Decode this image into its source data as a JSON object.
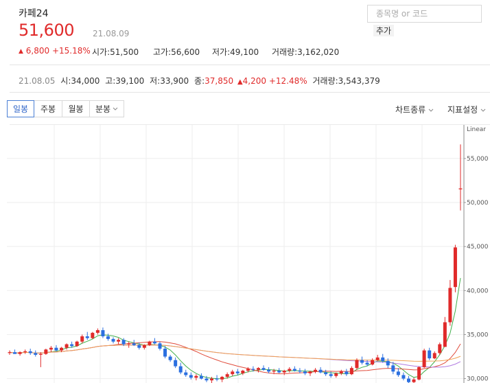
{
  "stock": {
    "name": "카페24",
    "price": "51,600",
    "date": "21.08.09",
    "change_arrow": "▲",
    "change": "6,800",
    "change_pct": "+15.18%",
    "open_label": "시가",
    "open": "51,500",
    "high_label": "고가",
    "high": "56,600",
    "low_label": "저가",
    "low": "49,100",
    "volume_label": "거래량",
    "volume": "3,162,020"
  },
  "search": {
    "placeholder": "종목명 or 코드",
    "add_label": "추가"
  },
  "prev_day": {
    "date": "21.08.05",
    "open_label": "시",
    "open": "34,000",
    "high_label": "고",
    "high": "39,100",
    "low_label": "저",
    "low": "33,900",
    "close_label": "종",
    "close": "37,850",
    "change_arrow": "▲",
    "change": "4,200",
    "change_pct": "+12.48%",
    "volume_label": "거래량",
    "volume": "3,543,379"
  },
  "toolbar": {
    "tabs": [
      "일봉",
      "주봉",
      "월봉",
      "분봉"
    ],
    "active_tab": "일봉",
    "chart_type_label": "차트종류",
    "indicator_label": "지표설정"
  },
  "colors": {
    "up": "#e02a2a",
    "down": "#2b6fe0",
    "ma5": "#3fae49",
    "ma20": "#e04a3a",
    "ma60": "#b07ae0",
    "ma120": "#f0a050",
    "active_tab": "#4a7fd4"
  },
  "chart_data": {
    "type": "candlestick",
    "y_scale_label": "Linear",
    "ylim": [
      29500,
      58500
    ],
    "yticks": [
      "30,000",
      "35,000",
      "40,000",
      "45,000",
      "50,000",
      "55,000"
    ],
    "ytick_values": [
      30000,
      35000,
      40000,
      45000,
      50000,
      55000
    ],
    "last_candle": {
      "open": 51500,
      "high": 56600,
      "low": 49100,
      "close": 51600
    },
    "candles": [
      [
        32900,
        33200,
        32700,
        33000
      ],
      [
        33000,
        33300,
        32800,
        32800
      ],
      [
        32800,
        33100,
        32600,
        33000
      ],
      [
        33000,
        33300,
        32800,
        33100
      ],
      [
        33100,
        33400,
        32700,
        32900
      ],
      [
        32900,
        33200,
        32500,
        32700
      ],
      [
        32700,
        33000,
        31300,
        32800
      ],
      [
        32800,
        33400,
        32700,
        33300
      ],
      [
        33300,
        33700,
        33000,
        33500
      ],
      [
        33500,
        33800,
        33100,
        33200
      ],
      [
        33200,
        33600,
        33000,
        33500
      ],
      [
        33500,
        34000,
        33300,
        33900
      ],
      [
        33900,
        34200,
        33500,
        33700
      ],
      [
        33700,
        34300,
        33600,
        34200
      ],
      [
        34200,
        35000,
        34000,
        34800
      ],
      [
        34800,
        35300,
        34400,
        34600
      ],
      [
        34600,
        35300,
        34500,
        35200
      ],
      [
        35200,
        35700,
        35000,
        35500
      ],
      [
        35500,
        35800,
        34600,
        34800
      ],
      [
        34800,
        35100,
        34300,
        34500
      ],
      [
        34500,
        34700,
        34000,
        34200
      ],
      [
        34200,
        34600,
        33900,
        34400
      ],
      [
        34400,
        34600,
        33700,
        33900
      ],
      [
        33900,
        34200,
        33500,
        34000
      ],
      [
        34000,
        34400,
        33700,
        33800
      ],
      [
        33800,
        34100,
        33300,
        33500
      ],
      [
        33500,
        33900,
        33300,
        33800
      ],
      [
        33800,
        34300,
        33700,
        34200
      ],
      [
        34200,
        34600,
        33900,
        34000
      ],
      [
        34000,
        34200,
        33200,
        33400
      ],
      [
        33400,
        33700,
        32300,
        32500
      ],
      [
        32500,
        32700,
        31900,
        32100
      ],
      [
        32100,
        32400,
        31200,
        31400
      ],
      [
        31400,
        31800,
        30500,
        30700
      ],
      [
        30700,
        31000,
        30200,
        30400
      ],
      [
        30400,
        30700,
        29900,
        30100
      ],
      [
        30100,
        30500,
        29800,
        30300
      ],
      [
        30300,
        30600,
        29900,
        30000
      ],
      [
        30000,
        30300,
        29600,
        29800
      ],
      [
        29800,
        30200,
        29500,
        30000
      ],
      [
        30000,
        30400,
        29700,
        29900
      ],
      [
        29900,
        30300,
        29600,
        30200
      ],
      [
        30200,
        30700,
        30000,
        30500
      ],
      [
        30500,
        31000,
        30300,
        30800
      ],
      [
        30800,
        31100,
        30400,
        30600
      ],
      [
        30600,
        31000,
        30400,
        30900
      ],
      [
        30900,
        31300,
        30700,
        31100
      ],
      [
        31100,
        31400,
        30800,
        31000
      ],
      [
        31000,
        31300,
        30700,
        31200
      ],
      [
        31200,
        31500,
        30900,
        31000
      ],
      [
        31000,
        31300,
        30600,
        30800
      ],
      [
        30800,
        31100,
        30500,
        30900
      ],
      [
        30900,
        31200,
        30600,
        30700
      ],
      [
        30700,
        31000,
        30400,
        30900
      ],
      [
        30900,
        31300,
        30700,
        31100
      ],
      [
        31100,
        31400,
        30800,
        30900
      ],
      [
        30900,
        31200,
        30600,
        30800
      ],
      [
        30800,
        31100,
        30400,
        30600
      ],
      [
        30600,
        30900,
        30300,
        30800
      ],
      [
        30800,
        31200,
        30600,
        31000
      ],
      [
        31000,
        31300,
        30600,
        30700
      ],
      [
        30700,
        31000,
        30300,
        30500
      ],
      [
        30500,
        30800,
        30100,
        30300
      ],
      [
        30300,
        30700,
        30100,
        30600
      ],
      [
        30600,
        31000,
        30400,
        30800
      ],
      [
        30800,
        31100,
        30300,
        30500
      ],
      [
        30500,
        31400,
        30400,
        31200
      ],
      [
        31200,
        32300,
        31000,
        32100
      ],
      [
        32100,
        32500,
        31600,
        31800
      ],
      [
        31800,
        32100,
        31400,
        31600
      ],
      [
        31600,
        32300,
        31500,
        32100
      ],
      [
        32100,
        32700,
        32000,
        32400
      ],
      [
        32400,
        32800,
        31800,
        32000
      ],
      [
        32000,
        32300,
        31200,
        31500
      ],
      [
        31500,
        31900,
        30500,
        30800
      ],
      [
        30800,
        31200,
        30200,
        30400
      ],
      [
        30400,
        30700,
        29800,
        30000
      ],
      [
        30000,
        30300,
        29400,
        29600
      ],
      [
        29600,
        30100,
        29400,
        29900
      ],
      [
        29900,
        31400,
        29800,
        31300
      ],
      [
        31300,
        33400,
        31200,
        33200
      ],
      [
        33200,
        33500,
        32100,
        32300
      ],
      [
        32300,
        33100,
        32200,
        32900
      ],
      [
        32900,
        34100,
        32700,
        33900
      ],
      [
        33600,
        37000,
        33600,
        36400
      ],
      [
        36400,
        41200,
        36000,
        40300
      ],
      [
        40400,
        45200,
        39800,
        44900
      ],
      [
        51500,
        56600,
        49100,
        51600
      ]
    ]
  }
}
